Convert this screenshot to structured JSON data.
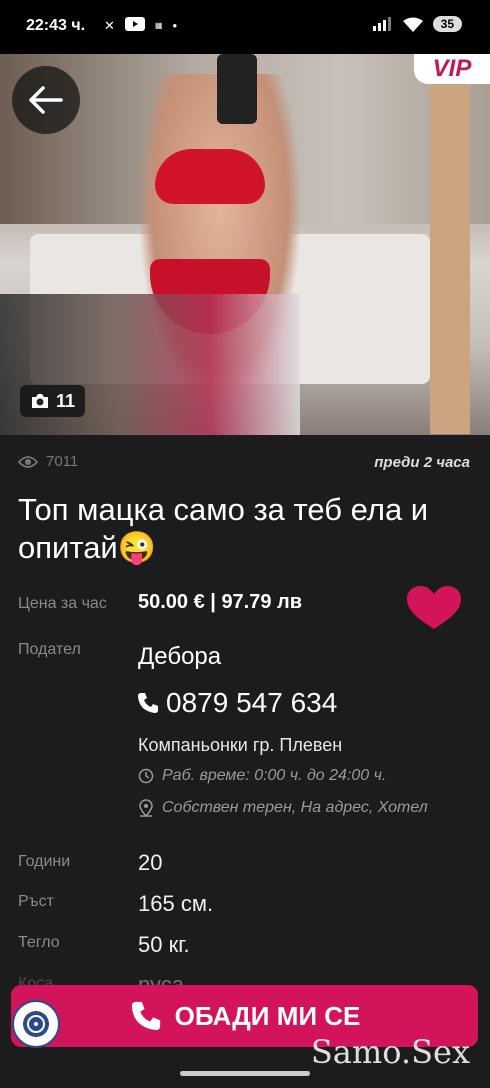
{
  "status_bar": {
    "time": "22:43 ч.",
    "battery": "35"
  },
  "ad": {
    "vip_badge": "VIP",
    "photo_count": "11",
    "views": "7011",
    "posted": "преди 2 часа",
    "title": "Топ мацка само за теб ела и опитай😜",
    "price_label": "Цена за час",
    "price": "50.00 € | 97.79 лв",
    "seller_label": "Подател",
    "seller_name": "Дебора",
    "phone": "0879 547 634",
    "category": "Компаньонки гр. Плевен",
    "hours": "Раб. време: 0:00 ч. до 24:00 ч.",
    "places": "Собствен терен, На адрес, Хотел",
    "attributes": [
      {
        "label": "Години",
        "value": "20"
      },
      {
        "label": "Ръст",
        "value": "165 см."
      },
      {
        "label": "Тегло",
        "value": "50 кг."
      },
      {
        "label": "Коса",
        "value": "руса"
      }
    ]
  },
  "call_button": "ОБАДИ МИ СЕ",
  "watermark": "Samo.Sex",
  "colors": {
    "accent": "#d4145a",
    "background": "#1c1c1e"
  }
}
